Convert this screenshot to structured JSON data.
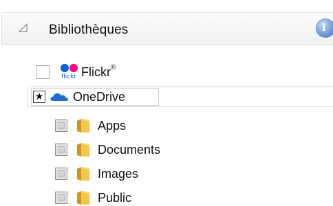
{
  "libraries": {
    "title": "Bibliothèques",
    "info_icon": "info-icon",
    "collapse_icon": "collapse-triangle-icon"
  },
  "services": [
    {
      "label": "Flickr",
      "mark": "®",
      "icon": "flickr-logo",
      "checked": false
    },
    {
      "label": "OneDrive",
      "icon": "onedrive-cloud-icon",
      "state_glyph": "★"
    }
  ],
  "folders": [
    {
      "label": "Apps",
      "icon": "folder-icon",
      "checked": false
    },
    {
      "label": "Documents",
      "icon": "folder-icon",
      "checked": false
    },
    {
      "label": "Images",
      "icon": "folder-icon",
      "checked": false
    },
    {
      "label": "Public",
      "icon": "folder-icon",
      "checked": false
    }
  ],
  "colors": {
    "flickr_blue": "#0063dc",
    "flickr_pink": "#ff0084",
    "onedrive_blue": "#1a6fd1",
    "folder_yellow": "#f3c64a"
  }
}
